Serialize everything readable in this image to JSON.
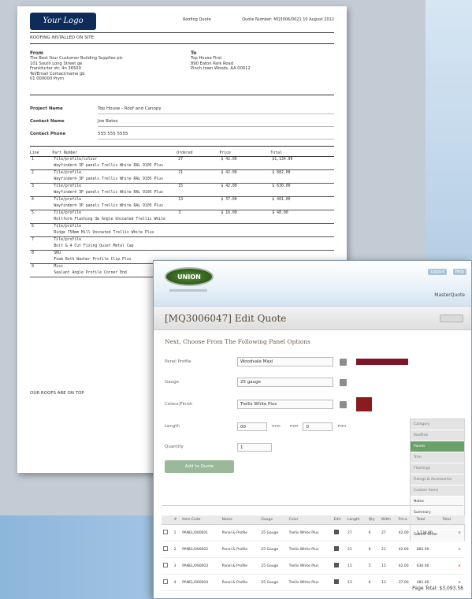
{
  "document": {
    "logo_text": "Your Logo",
    "header_center": "Roofing Quote",
    "header_right": "Quote Number: MQ3006/0021 10 August 2012",
    "subtitle": "ROOFING INSTALLED ON SITE",
    "from": {
      "heading": "From",
      "lines": [
        "The Best Your Customer Building Supplies plc",
        "101 South Long Street ge",
        "Frankfurter str. 4n 36500",
        "Tel/Email Contact/name gb",
        "01 000000 Prym"
      ]
    },
    "to": {
      "heading": "To",
      "lines": [
        "Top House First",
        "890 Eaton Park Road",
        "Pinch town Woods, AA 00012"
      ]
    },
    "project": [
      {
        "label": "Project Name",
        "value": "Top House - Roof and Canopy"
      },
      {
        "label": "Contact Name",
        "value": "Joe Bates"
      },
      {
        "label": "Contact Phone",
        "value": "555 555 5555"
      }
    ],
    "table_headers": [
      "Line",
      "Part Number",
      "Ordered",
      "Price",
      "Total"
    ],
    "items": [
      {
        "line": "1",
        "part": "Tile/profile/colour",
        "desc": "Wayfinder® 3P panels Trellis White RAL 9105 Plus",
        "qty": "27",
        "price": "$ 42.00",
        "total": "$1,134.00"
      },
      {
        "line": "2",
        "part": "Tile/profile",
        "desc": "Wayfinder® 3P panels Trellis White RAL 9105 Plus",
        "qty": "21",
        "price": "$ 42.00",
        "total": "$ 882.00"
      },
      {
        "line": "3",
        "part": "Tile/profile",
        "desc": "Wayfinder® 3P panels Trellis White RAL 9105 Plus",
        "qty": "15",
        "price": "$ 42.00",
        "total": "$ 630.00"
      },
      {
        "line": "4",
        "part": "Tile/profile",
        "desc": "Wayfinder® 3P panels Trellis White RAL 9105 Plus",
        "qty": "13",
        "price": "$ 37.00",
        "total": "$ 481.00"
      },
      {
        "line": "5",
        "part": "Tile/profile",
        "desc": "Rollform Flashing 3m Angle Uncoated Trellis White",
        "qty": "3",
        "price": "$ 16.00",
        "total": "$ 48.00"
      },
      {
        "line": "6",
        "part": "Tile/profile",
        "desc": "Ridge 750mm Mill Uncoated Trellis White Plus",
        "qty": "",
        "price": "",
        "total": ""
      },
      {
        "line": "7",
        "part": "Tile/profile",
        "desc": "Bolt & 4 Cut Fixing Quiet Metal Cap",
        "qty": "",
        "price": "",
        "total": ""
      },
      {
        "line": "8",
        "part": "SKU",
        "desc": "Foam Both Washer Profile Clip Plus",
        "qty": "",
        "price": "",
        "total": ""
      },
      {
        "line": "9",
        "part": "Misc",
        "desc": "Sealant Angle Profile Corner End",
        "qty": "",
        "price": "",
        "total": ""
      }
    ],
    "footnote": "OUR ROOFS ARE ON TOP"
  },
  "app": {
    "logo_text": "UNION",
    "toplinks": [
      "Logout",
      "Help"
    ],
    "product_name": "MasterQuote",
    "page_title": "[MQ3006047] Edit Quote",
    "section_title": "Next, Choose From The Following Panel Options",
    "fields": {
      "panel_profile": {
        "label": "Panel Profile",
        "value": "Woodvale Maxi"
      },
      "gauge": {
        "label": "Gauge",
        "value": "25 gauge"
      },
      "colour": {
        "label": "Colour/Finish",
        "value": "Trellis White Plus"
      },
      "length": {
        "label": "Length",
        "value1": "00",
        "unit1": "mm",
        "mid": "mm",
        "value2": "0",
        "unit2": "mm"
      },
      "quantity": {
        "label": "Quantity",
        "value": "1"
      }
    },
    "add_button": "Add to Quote",
    "side_menu": [
      "Category",
      "Roofline",
      "Panels",
      "Trim",
      "Flashings",
      "Fixings & Accessories",
      "Custom Items",
      "Notes",
      "Summary",
      "Terms and Details",
      "Submit Order"
    ],
    "side_active_index": 2,
    "grid_headers": [
      "",
      "#",
      "Item Code",
      "Name",
      "Gauge",
      "Color",
      "Edit",
      "Length",
      "Qty",
      "Wdth",
      "Price",
      "Total",
      "Total",
      ""
    ],
    "grid_rows": [
      [
        "",
        "1",
        "PANEL/000001",
        "Panel & Profile",
        "25 Gauge",
        "Trellis White Plus",
        "",
        "27",
        "6",
        "27",
        "42.00",
        "1,134.00"
      ],
      [
        "",
        "2",
        "PANEL/000002",
        "Panel & Profile",
        "25 Gauge",
        "Trellis White Plus",
        "",
        "21",
        "6",
        "21",
        "42.00",
        "882.00"
      ],
      [
        "",
        "3",
        "PANEL/000003",
        "Panel & Profile",
        "25 Gauge",
        "Trellis White Plus",
        "",
        "15",
        "5",
        "15",
        "42.00",
        "630.00"
      ],
      [
        "",
        "4",
        "PANEL/000004",
        "Panel & Profile",
        "25 Gauge",
        "Trellis White Plus",
        "",
        "13",
        "6",
        "13",
        "37.00",
        "481.00"
      ]
    ],
    "page_total": "Page Total: $3,093.58"
  },
  "colors": {
    "swatch_bar": "#7d1628",
    "swatch_square": "#8a1c1e",
    "accent_green": "#6aa06a"
  }
}
